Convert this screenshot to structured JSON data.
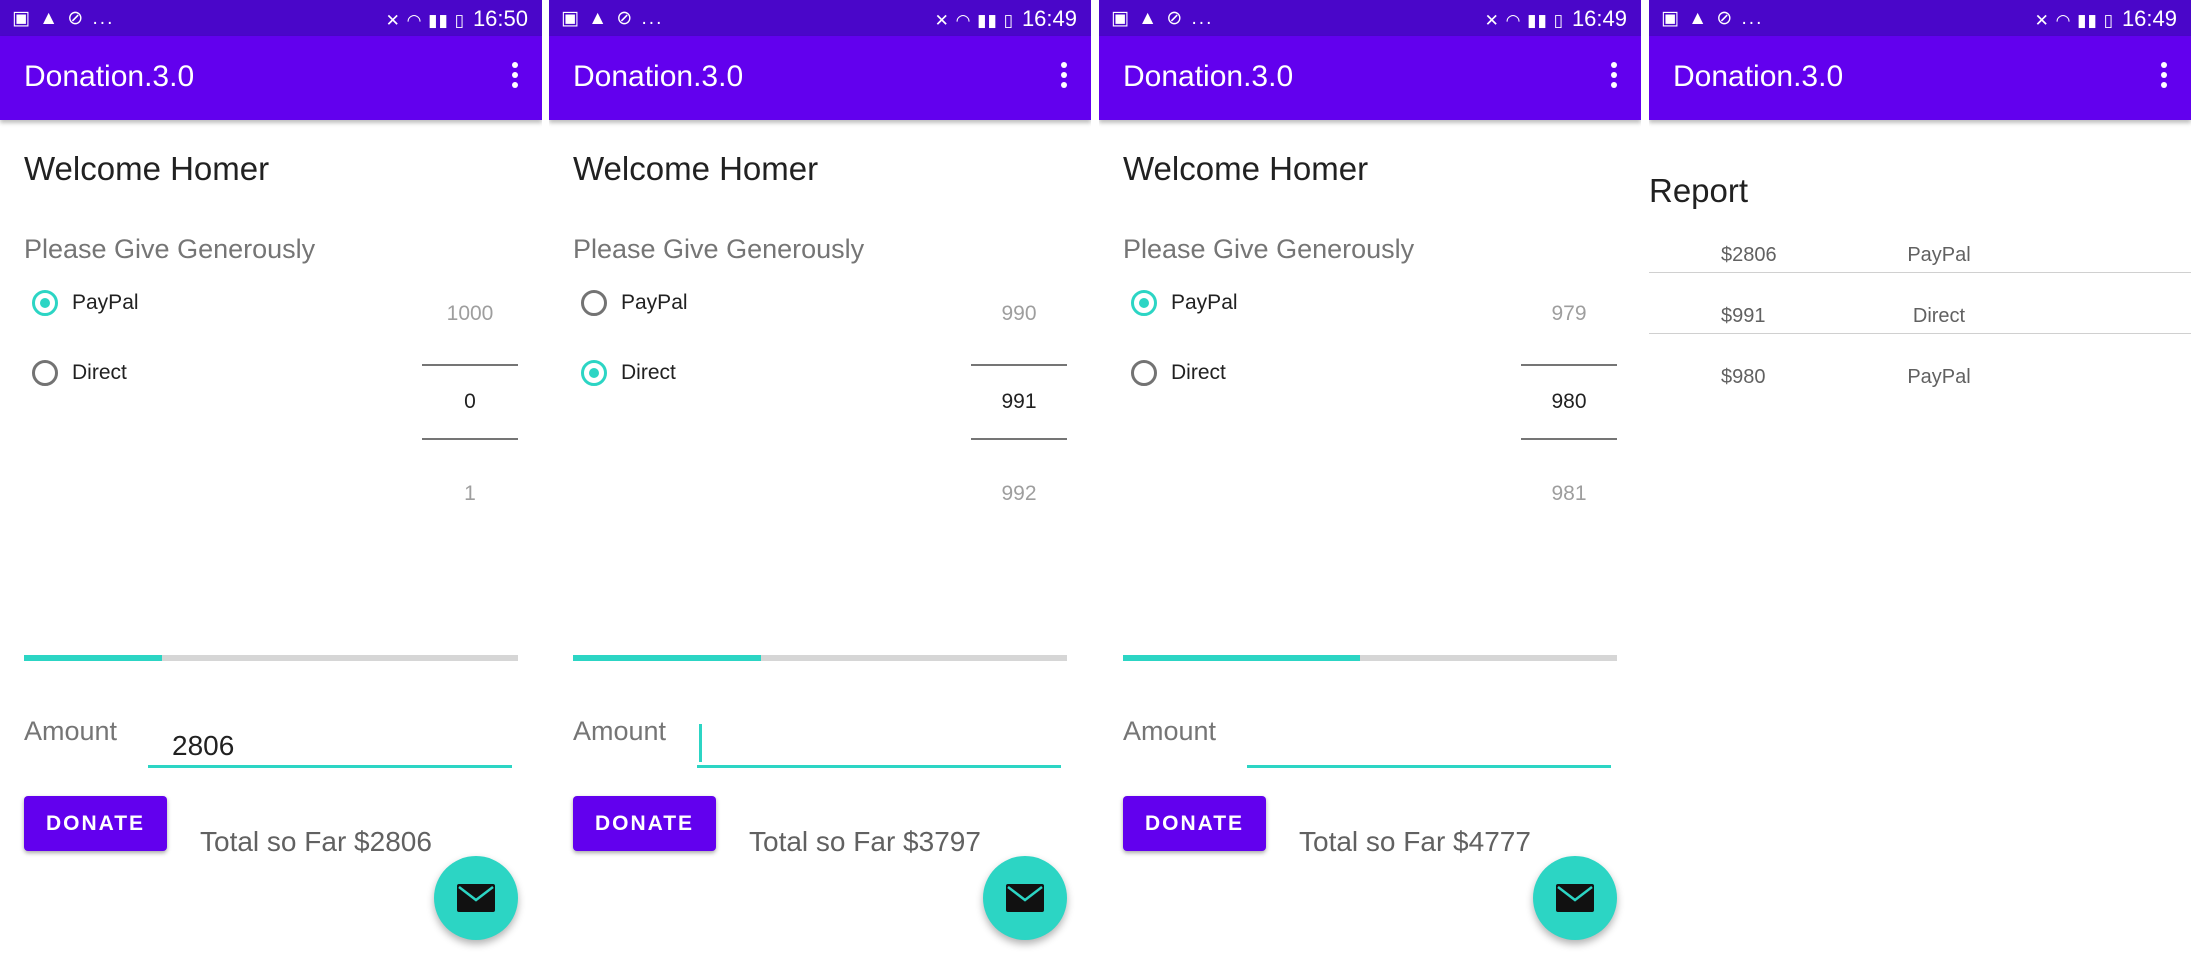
{
  "app": {
    "title": "Donation.3.0",
    "colors": {
      "primary": "#6200ee",
      "status_bar": "#4a06c9",
      "accent": "#2cd5c4"
    }
  },
  "status_left": "▣ ▲ ⊘ ...",
  "screens": [
    {
      "time": "16:50",
      "welcome": "Welcome Homer",
      "prompt": "Please Give Generously",
      "payment_methods": [
        {
          "label": "PayPal",
          "checked": true
        },
        {
          "label": "Direct",
          "checked": false
        }
      ],
      "picker": {
        "prev": "1000",
        "current": "0",
        "next": "1"
      },
      "progress": 0.28,
      "amount_label": "Amount",
      "amount_value": "2806",
      "donate_label": "DONATE",
      "total_text": "Total so Far $2806",
      "fab_icon": "email-icon"
    },
    {
      "time": "16:49",
      "welcome": "Welcome Homer",
      "prompt": "Please Give Generously",
      "payment_methods": [
        {
          "label": "PayPal",
          "checked": false
        },
        {
          "label": "Direct",
          "checked": true
        }
      ],
      "picker": {
        "prev": "990",
        "current": "991",
        "next": "992"
      },
      "progress": 0.38,
      "amount_label": "Amount",
      "amount_value": "",
      "donate_label": "DONATE",
      "total_text": "Total so Far $3797",
      "fab_icon": "email-icon"
    },
    {
      "time": "16:49",
      "welcome": "Welcome Homer",
      "prompt": "Please Give Generously",
      "payment_methods": [
        {
          "label": "PayPal",
          "checked": true
        },
        {
          "label": "Direct",
          "checked": false
        }
      ],
      "picker": {
        "prev": "979",
        "current": "980",
        "next": "981"
      },
      "progress": 0.48,
      "amount_label": "Amount",
      "amount_value": "",
      "donate_label": "DONATE",
      "total_text": "Total so Far $4777",
      "fab_icon": "email-icon"
    }
  ],
  "report": {
    "time": "16:49",
    "title": "Report",
    "rows": [
      {
        "amount": "$2806",
        "method": "PayPal"
      },
      {
        "amount": "$991",
        "method": "Direct"
      },
      {
        "amount": "$980",
        "method": "PayPal"
      }
    ]
  }
}
